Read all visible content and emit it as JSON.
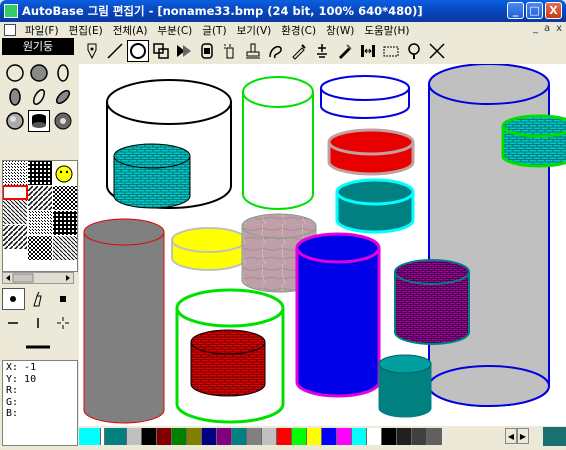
{
  "window": {
    "title": "AutoBase 그림 편집기 - [noname33.bmp (24 bit, 100% 640*480)]",
    "buttons": [
      "_",
      "□",
      "X"
    ]
  },
  "menu": {
    "items": [
      "파일(F)",
      "편집(E)",
      "전체(A)",
      "부분(C)",
      "글(T)",
      "보기(V)",
      "환경(C)",
      "창(W)",
      "도움말(H)"
    ],
    "mdi_buttons": [
      "_",
      "a",
      "x"
    ]
  },
  "toolbar": {
    "tools": [
      "pen-nib-icon",
      "line-icon",
      "ellipse-icon",
      "overlap-rect-icon",
      "arrow-shape-icon",
      "cylinder-icon",
      "spray-icon",
      "stamp-icon",
      "curve-icon",
      "dropper-icon",
      "lift-icon",
      "brush-icon",
      "resize-icon",
      "rect-select-icon",
      "zoom-icon",
      "cross-icon"
    ],
    "active": "ellipse-icon"
  },
  "left_panel": {
    "mode_label": "원기둥",
    "coords": {
      "x": "X: -1",
      "y": "Y: 10",
      "r": "R:",
      "g": "G:",
      "b": "B:"
    }
  },
  "palette": {
    "colors": [
      "#00ffff",
      "#ffffff",
      "#008080",
      "#c0c0c0",
      "#000000",
      "#800000",
      "#008000",
      "#808000",
      "#000080",
      "#800080",
      "#008080",
      "#808080",
      "#c0c0c0",
      "#ff0000",
      "#00ff00",
      "#ffff00",
      "#0000ff",
      "#ff00ff",
      "#00ffff",
      "#ffffff",
      "#000000",
      "#202020",
      "#404040",
      "#606060"
    ]
  },
  "colors": {
    "title_blue": "#0842b8",
    "canvas_bg": "#ffffff"
  }
}
